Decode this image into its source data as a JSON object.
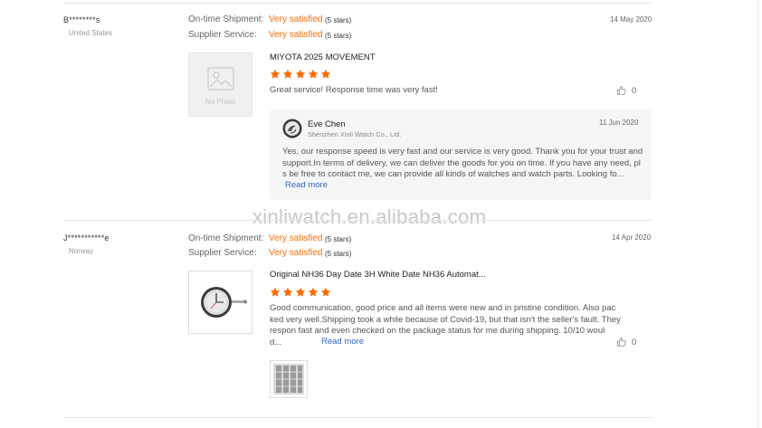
{
  "watermark": "xinliwatch.en.alibaba.com",
  "labels": {
    "ontime": "On-time Shipment:",
    "supplier_service": "Supplier Service:"
  },
  "colors": {
    "accent": "#ff6a00",
    "link": "#3366cc",
    "star": "#ff6a00"
  },
  "reviews": [
    {
      "buyer": "B********s",
      "country": "United States",
      "ontime_value": "Very satisfied",
      "ontime_stars": "(5 stars)",
      "service_value": "Very satisfied",
      "service_stars": "(5 stars)",
      "date": "14 May 2020",
      "product_image_placeholder": "No Photo",
      "product_title": "MIYOTA 2025 MOVEMENT",
      "rating": 5,
      "text": "Great service! Response time was very fast!",
      "likes": "0",
      "reply": {
        "seller_name": "Eve Chen",
        "company": "Shenzhen Xinli Watch Co., Ltd.",
        "date": "11 Jun 2020",
        "text_lines": [
          "Yes, our response speed is very fast and our service is very good. Thank you for your trust and",
          "support.In terms of delivery, we can deliver the goods for you on time. If you have any need, pl",
          "s be free to contact me, we can provide all kinds of watches and watch parts. Looking fo..."
        ],
        "read_more": "Read more"
      }
    },
    {
      "buyer": "J***********e",
      "country": "Norway",
      "ontime_value": "Very satisfied",
      "ontime_stars": "(5 stars)",
      "service_value": "Very satisfied",
      "service_stars": "(5 stars)",
      "date": "14 Apr 2020",
      "product_title": "Original NH36 Day Date 3H White Date NH36 Automat...",
      "rating": 5,
      "text_lines": [
        "Good communication, good price and all items were new and in pristine condition. Also pac",
        "ked very well.Shipping took a while because of Covid-19, but that isn't the seller's fault. They",
        "respon fast and even checked on the package status for me during shipping. 10/10 woul",
        "d..."
      ],
      "read_more": "Read more",
      "likes": "0"
    }
  ]
}
